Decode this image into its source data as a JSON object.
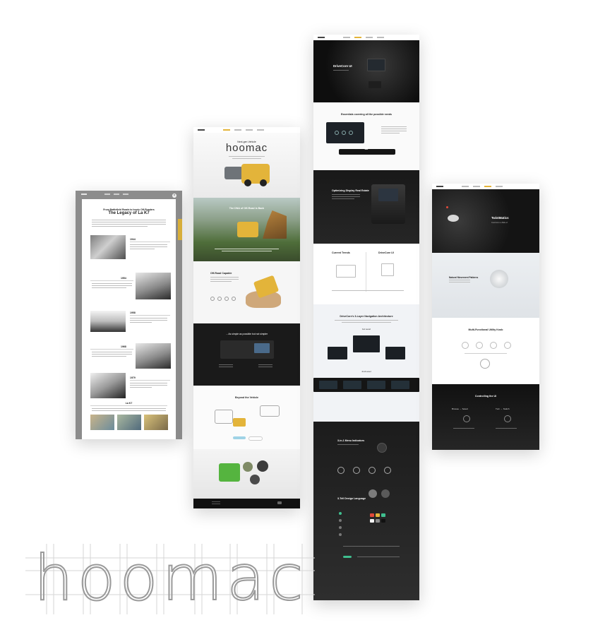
{
  "brand": {
    "wordmark": "hoomac",
    "accent": "#e3b43a",
    "dark": "#151515",
    "green": "#3fbf8f"
  },
  "mockup_legacy": {
    "headline": "From Battlefield Roads to Iconic Off-Roaders",
    "title": "The Legacy of La K7",
    "timeline": [
      "1944",
      "1954",
      "1958",
      "1968",
      "1979"
    ],
    "footer_label": "La K7"
  },
  "mockup_product": {
    "kicker": "Next-gen Vehicle",
    "title": "hoomac",
    "section_outdoor": "The DNA of Off-Road is Back",
    "section_capable": "Off-Road Capable",
    "section_design": "... As simple as possible but not simpler",
    "section_beyond": "Beyond the Vehicle"
  },
  "mockup_ui": {
    "hero_title": "DriveCore UI",
    "speed": "40",
    "section_essentials": "Essentials covering all the possible needs",
    "section_optimizing": "Optimizing Display Real Estate",
    "col_current": "Current Trends",
    "col_drivecore": "DriveCore UI",
    "section_architecture": "DriveCore's 3-Layer Navigation Architecture",
    "layer1": "1st Level",
    "layer2": "2nd Level",
    "section_indicators": "3-in-1 Menu Indicators",
    "section_design_language": "3-Tell Design Language"
  },
  "mockup_controller": {
    "hero_title": "TwistMatics",
    "hero_sub": "Control in a flick of",
    "section_natural": "Natural Movement Patterns",
    "section_multi": "Multi-Functional Utility Knob",
    "section_controlling": "Controlling the UI",
    "mode_a": "Browse → Select",
    "mode_b": "Turn → Switch"
  }
}
